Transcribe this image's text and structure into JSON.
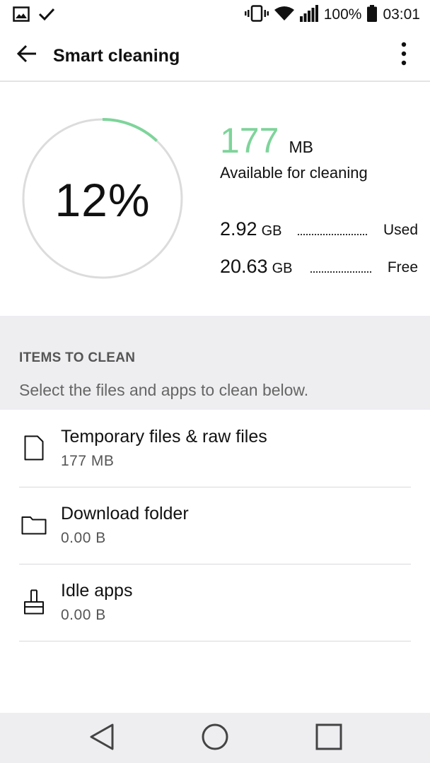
{
  "status_bar": {
    "left_icons": [
      "gallery-icon",
      "check-icon"
    ],
    "right_icons": [
      "vibrate-icon",
      "wifi-icon",
      "signal-icon"
    ],
    "battery_text": "100%",
    "time": "03:01"
  },
  "app_bar": {
    "title": "Smart cleaning",
    "back_icon": "arrow-left-icon",
    "more_icon": "more-vertical-icon"
  },
  "summary": {
    "gauge_percent": "12%",
    "gauge_fraction": 0.12,
    "available_value": "177",
    "available_unit": "MB",
    "available_label": "Available for cleaning",
    "used_value": "2.92",
    "used_unit": "GB",
    "used_label": "Used",
    "free_value": "20.63",
    "free_unit": "GB",
    "free_label": "Free",
    "accent_color": "#7ed49a"
  },
  "section": {
    "title": "ITEMS TO CLEAN",
    "subtitle": "Select the files and apps to clean below."
  },
  "items": [
    {
      "icon": "file-icon",
      "title": "Temporary files & raw files",
      "size": "177  MB"
    },
    {
      "icon": "folder-icon",
      "title": "Download folder",
      "size": "0.00  B"
    },
    {
      "icon": "broom-icon",
      "title": "Idle apps",
      "size": "0.00  B"
    }
  ],
  "nav_bar": {
    "buttons": [
      "back-triangle-icon",
      "home-circle-icon",
      "recents-square-icon"
    ]
  }
}
